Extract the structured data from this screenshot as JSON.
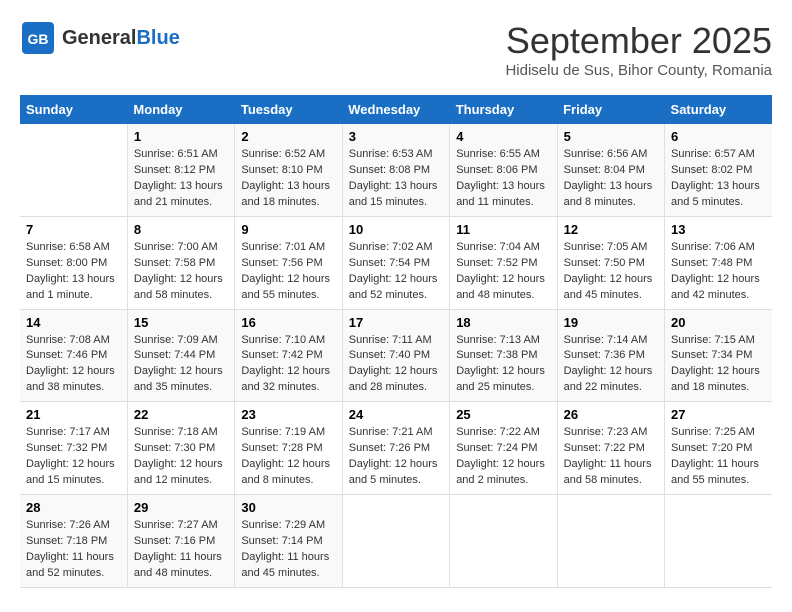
{
  "header": {
    "logo_general": "General",
    "logo_blue": "Blue",
    "month": "September 2025",
    "location": "Hidiselu de Sus, Bihor County, Romania"
  },
  "weekdays": [
    "Sunday",
    "Monday",
    "Tuesday",
    "Wednesday",
    "Thursday",
    "Friday",
    "Saturday"
  ],
  "weeks": [
    [
      {
        "day": "",
        "info": ""
      },
      {
        "day": "1",
        "info": "Sunrise: 6:51 AM\nSunset: 8:12 PM\nDaylight: 13 hours and 21 minutes."
      },
      {
        "day": "2",
        "info": "Sunrise: 6:52 AM\nSunset: 8:10 PM\nDaylight: 13 hours and 18 minutes."
      },
      {
        "day": "3",
        "info": "Sunrise: 6:53 AM\nSunset: 8:08 PM\nDaylight: 13 hours and 15 minutes."
      },
      {
        "day": "4",
        "info": "Sunrise: 6:55 AM\nSunset: 8:06 PM\nDaylight: 13 hours and 11 minutes."
      },
      {
        "day": "5",
        "info": "Sunrise: 6:56 AM\nSunset: 8:04 PM\nDaylight: 13 hours and 8 minutes."
      },
      {
        "day": "6",
        "info": "Sunrise: 6:57 AM\nSunset: 8:02 PM\nDaylight: 13 hours and 5 minutes."
      }
    ],
    [
      {
        "day": "7",
        "info": "Sunrise: 6:58 AM\nSunset: 8:00 PM\nDaylight: 13 hours and 1 minute."
      },
      {
        "day": "8",
        "info": "Sunrise: 7:00 AM\nSunset: 7:58 PM\nDaylight: 12 hours and 58 minutes."
      },
      {
        "day": "9",
        "info": "Sunrise: 7:01 AM\nSunset: 7:56 PM\nDaylight: 12 hours and 55 minutes."
      },
      {
        "day": "10",
        "info": "Sunrise: 7:02 AM\nSunset: 7:54 PM\nDaylight: 12 hours and 52 minutes."
      },
      {
        "day": "11",
        "info": "Sunrise: 7:04 AM\nSunset: 7:52 PM\nDaylight: 12 hours and 48 minutes."
      },
      {
        "day": "12",
        "info": "Sunrise: 7:05 AM\nSunset: 7:50 PM\nDaylight: 12 hours and 45 minutes."
      },
      {
        "day": "13",
        "info": "Sunrise: 7:06 AM\nSunset: 7:48 PM\nDaylight: 12 hours and 42 minutes."
      }
    ],
    [
      {
        "day": "14",
        "info": "Sunrise: 7:08 AM\nSunset: 7:46 PM\nDaylight: 12 hours and 38 minutes."
      },
      {
        "day": "15",
        "info": "Sunrise: 7:09 AM\nSunset: 7:44 PM\nDaylight: 12 hours and 35 minutes."
      },
      {
        "day": "16",
        "info": "Sunrise: 7:10 AM\nSunset: 7:42 PM\nDaylight: 12 hours and 32 minutes."
      },
      {
        "day": "17",
        "info": "Sunrise: 7:11 AM\nSunset: 7:40 PM\nDaylight: 12 hours and 28 minutes."
      },
      {
        "day": "18",
        "info": "Sunrise: 7:13 AM\nSunset: 7:38 PM\nDaylight: 12 hours and 25 minutes."
      },
      {
        "day": "19",
        "info": "Sunrise: 7:14 AM\nSunset: 7:36 PM\nDaylight: 12 hours and 22 minutes."
      },
      {
        "day": "20",
        "info": "Sunrise: 7:15 AM\nSunset: 7:34 PM\nDaylight: 12 hours and 18 minutes."
      }
    ],
    [
      {
        "day": "21",
        "info": "Sunrise: 7:17 AM\nSunset: 7:32 PM\nDaylight: 12 hours and 15 minutes."
      },
      {
        "day": "22",
        "info": "Sunrise: 7:18 AM\nSunset: 7:30 PM\nDaylight: 12 hours and 12 minutes."
      },
      {
        "day": "23",
        "info": "Sunrise: 7:19 AM\nSunset: 7:28 PM\nDaylight: 12 hours and 8 minutes."
      },
      {
        "day": "24",
        "info": "Sunrise: 7:21 AM\nSunset: 7:26 PM\nDaylight: 12 hours and 5 minutes."
      },
      {
        "day": "25",
        "info": "Sunrise: 7:22 AM\nSunset: 7:24 PM\nDaylight: 12 hours and 2 minutes."
      },
      {
        "day": "26",
        "info": "Sunrise: 7:23 AM\nSunset: 7:22 PM\nDaylight: 11 hours and 58 minutes."
      },
      {
        "day": "27",
        "info": "Sunrise: 7:25 AM\nSunset: 7:20 PM\nDaylight: 11 hours and 55 minutes."
      }
    ],
    [
      {
        "day": "28",
        "info": "Sunrise: 7:26 AM\nSunset: 7:18 PM\nDaylight: 11 hours and 52 minutes."
      },
      {
        "day": "29",
        "info": "Sunrise: 7:27 AM\nSunset: 7:16 PM\nDaylight: 11 hours and 48 minutes."
      },
      {
        "day": "30",
        "info": "Sunrise: 7:29 AM\nSunset: 7:14 PM\nDaylight: 11 hours and 45 minutes."
      },
      {
        "day": "",
        "info": ""
      },
      {
        "day": "",
        "info": ""
      },
      {
        "day": "",
        "info": ""
      },
      {
        "day": "",
        "info": ""
      }
    ]
  ]
}
